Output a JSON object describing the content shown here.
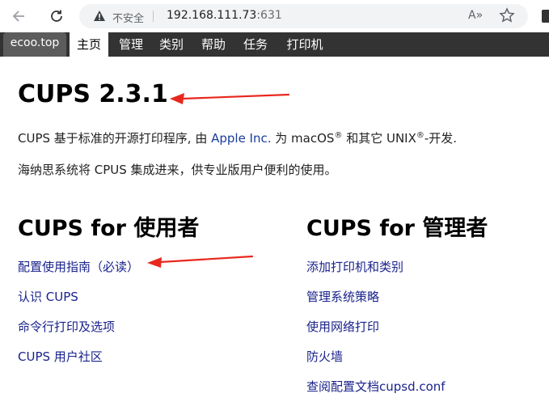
{
  "browser": {
    "insecure_label": "不安全",
    "url_host": "192.168.111.73",
    "url_port": ":631",
    "read_aloud": "A»"
  },
  "nav": {
    "brand": "ecoo.top",
    "tabs": [
      {
        "label": "主页",
        "active": true
      },
      {
        "label": "管理"
      },
      {
        "label": "类别"
      },
      {
        "label": "帮助"
      },
      {
        "label": "任务"
      },
      {
        "label": "打印机"
      }
    ]
  },
  "main": {
    "title": "CUPS 2.3.1",
    "intro": {
      "part1": "CUPS 基于标准的开源打印程序, 由 ",
      "link": "Apple Inc.",
      "part2": " 为 macOS",
      "sup1": "®",
      "part3": " 和其它 UNIX",
      "sup2": "®",
      "part4": "-开发."
    },
    "line2": "海纳思系统将 CPUS 集成进来，供专业版用户便利的使用。",
    "users": {
      "heading": "CUPS for 使用者",
      "links": [
        "配置使用指南（必读）",
        "认识 CUPS",
        "命令行打印及选项",
        "CUPS 用户社区"
      ]
    },
    "admins": {
      "heading": "CUPS for 管理者",
      "links": [
        "添加打印机和类别",
        "管理系统策略",
        "使用网络打印",
        "防火墙",
        "查阅配置文档cupsd.conf"
      ]
    }
  },
  "colors": {
    "navbar": "#333333",
    "brand_bg": "#5c5c5c",
    "link": "#1a238b",
    "annotation_arrow": "#e8281e"
  }
}
